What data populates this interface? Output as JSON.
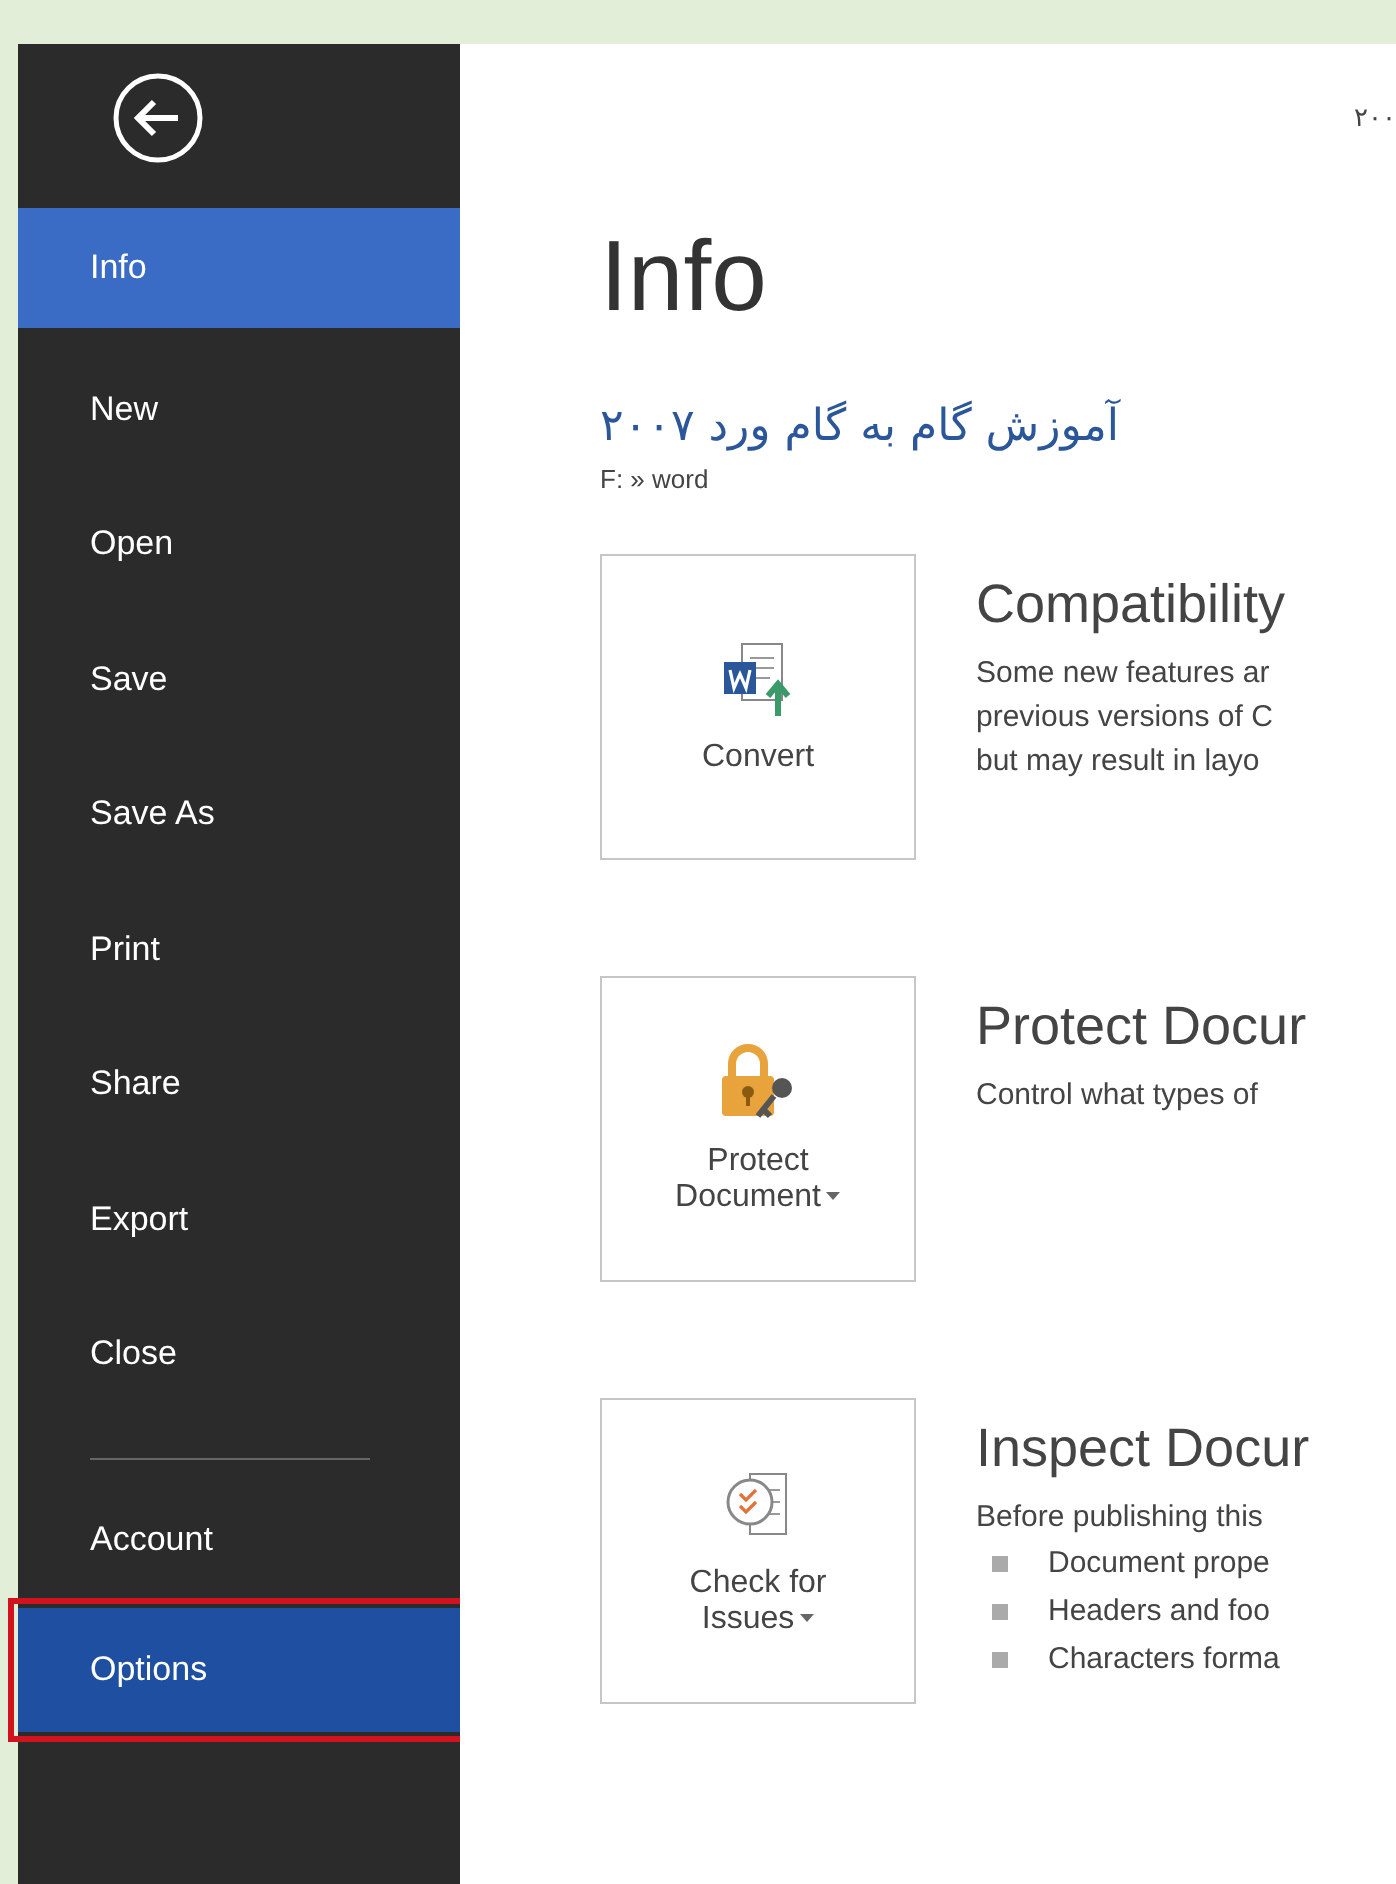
{
  "nav_main": [
    {
      "label": "Info",
      "selected": true,
      "hovered": false,
      "outlined": false
    },
    {
      "label": "New",
      "selected": false,
      "hovered": false,
      "outlined": false
    },
    {
      "label": "Open",
      "selected": false,
      "hovered": false,
      "outlined": false
    },
    {
      "label": "Save",
      "selected": false,
      "hovered": false,
      "outlined": false
    },
    {
      "label": "Save As",
      "selected": false,
      "hovered": false,
      "outlined": false
    },
    {
      "label": "Print",
      "selected": false,
      "hovered": false,
      "outlined": false
    },
    {
      "label": "Share",
      "selected": false,
      "hovered": false,
      "outlined": false
    },
    {
      "label": "Export",
      "selected": false,
      "hovered": false,
      "outlined": false
    },
    {
      "label": "Close",
      "selected": false,
      "hovered": false,
      "outlined": false
    }
  ],
  "nav_bottom": [
    {
      "label": "Account",
      "selected": false,
      "hovered": false,
      "outlined": false
    },
    {
      "label": "Options",
      "selected": false,
      "hovered": true,
      "outlined": true
    }
  ],
  "page": {
    "window_title": "۲۰۰",
    "heading": "Info",
    "doc_title": "آموزش گام به گام ورد ۲۰۰۷",
    "doc_path": "F: » word",
    "sections": [
      {
        "kind": "convert",
        "button": {
          "label": "Convert",
          "dropdown": false
        },
        "title": "Compatibility",
        "lines": [
          "Some new features ar",
          "previous versions of C",
          "but may result in layo"
        ]
      },
      {
        "kind": "protect",
        "button": {
          "label": "Protect Document",
          "dropdown": true
        },
        "title": "Protect Docur",
        "lines": [
          "Control what types of"
        ]
      },
      {
        "kind": "inspect",
        "button": {
          "label": "Check for Issues",
          "dropdown": true
        },
        "title": "Inspect Docur",
        "lines": [
          "Before publishing this"
        ],
        "bullets": [
          "Document prope",
          "Headers and foo",
          "Characters forma"
        ]
      }
    ]
  }
}
